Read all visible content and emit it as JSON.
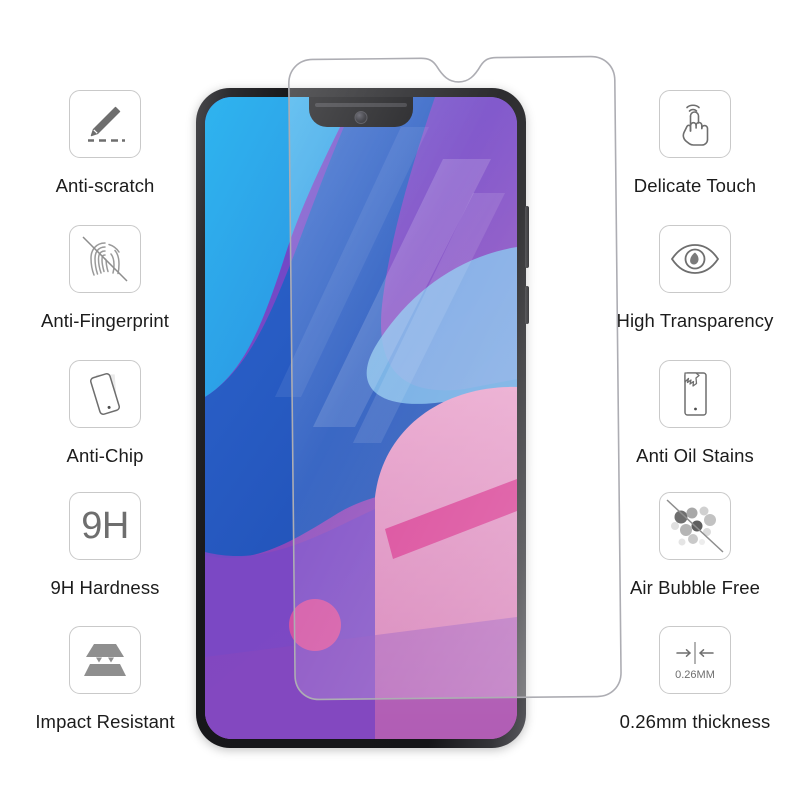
{
  "product": {
    "type": "tempered-glass-screen-protector-infographic",
    "background_color": "#ffffff",
    "icon_border_color": "#c9c9c9",
    "icon_glyph_color": "#6e6e6e",
    "label_color": "#1c1c1c"
  },
  "features_left": [
    {
      "id": "anti-scratch",
      "label": "Anti-scratch",
      "icon": "knife-scratch-icon"
    },
    {
      "id": "anti-fingerprint",
      "label": "Anti-Fingerprint",
      "icon": "fingerprint-crossed-icon"
    },
    {
      "id": "anti-chip",
      "label": "Anti-Chip",
      "icon": "tilted-phone-icon"
    },
    {
      "id": "9h-hardness",
      "label": "9H Hardness",
      "icon": "9h-text-icon",
      "icon_text": "9H"
    },
    {
      "id": "impact-resistant",
      "label": "Impact Resistant",
      "icon": "layered-glass-impact-icon"
    }
  ],
  "features_right": [
    {
      "id": "delicate-touch",
      "label": "Delicate Touch",
      "icon": "hand-tap-icon"
    },
    {
      "id": "high-transparency",
      "label": "High Transparency",
      "icon": "eye-icon"
    },
    {
      "id": "anti-oil-stains",
      "label": "Anti Oil Stains",
      "icon": "phone-oil-stain-icon"
    },
    {
      "id": "air-bubble-free",
      "label": "Air Bubble Free",
      "icon": "bubbles-crossed-icon"
    },
    {
      "id": "thickness",
      "label": "0.26mm thickness",
      "icon": "thickness-arrows-icon",
      "icon_text": "0.26MM"
    }
  ],
  "phone": {
    "name": "smartphone-with-waterdrop-notch",
    "frame_color": "#17171a",
    "wallpaper": {
      "name": "abstract-wave-wallpaper",
      "colors": [
        "#2aa7e8",
        "#1f5fc4",
        "#5d45c8",
        "#8047c0",
        "#d46bb0",
        "#e0559a"
      ]
    }
  },
  "protector": {
    "name": "tempered-glass-sheet",
    "edge_color": "#b8b8bd",
    "tint": "rgba(255,255,255,0.16)"
  }
}
